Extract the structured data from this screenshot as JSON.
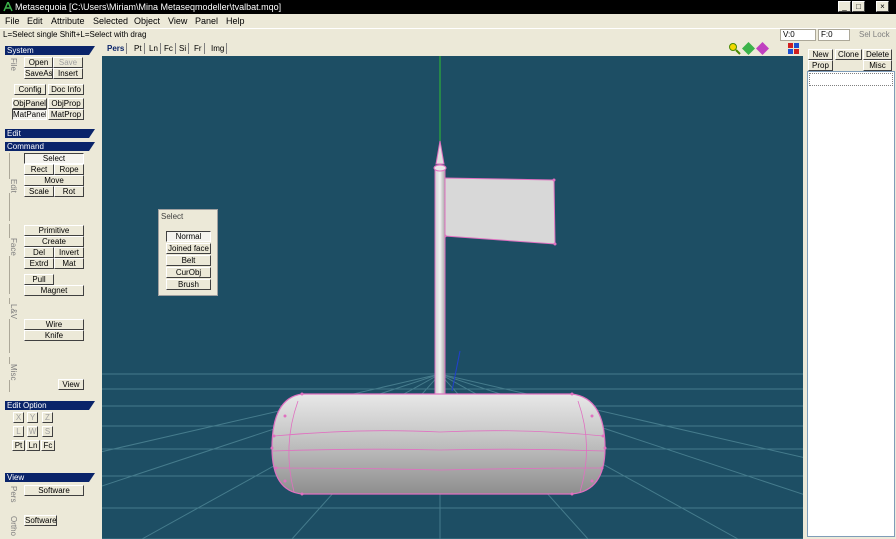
{
  "window": {
    "title": "Metasequoia [C:\\Users\\Miriam\\Mina Metaseqmodeller\\tvalbat.mqo]",
    "buttons": [
      "_",
      "□",
      "×"
    ]
  },
  "menu": [
    "File",
    "Edit",
    "Attribute",
    "Selected",
    "Object",
    "View",
    "Panel",
    "Help"
  ],
  "hint": "L=Select single  Shift+L=Select with drag",
  "readouts": {
    "v": "V:0",
    "f": "F:0",
    "sel_lock": "Sel Lock"
  },
  "left_panel": {
    "system": {
      "header": "System",
      "group_label": "File",
      "open": "Open",
      "save": "Save",
      "save_as": "SaveAs",
      "insert": "Insert",
      "config": "Config",
      "doc_info": "Doc Info",
      "obj_panel": "ObjPanel",
      "obj_prop": "ObjProp",
      "mat_panel": "MatPanel",
      "mat_prop": "MatProp"
    },
    "edit": {
      "header": "Edit"
    },
    "command": {
      "header": "Command",
      "edit_label": "Edit",
      "select": "Select",
      "rect": "Rect",
      "rope": "Rope",
      "move": "Move",
      "scale": "Scale",
      "rot": "Rot",
      "face_label": "Face",
      "primitive": "Primitive",
      "create": "Create",
      "del": "Del",
      "invert": "Invert",
      "extrd": "Extrd",
      "mat": "Mat",
      "pull": "Pull",
      "magnet": "Magnet",
      "lv_label": "L&V",
      "wire": "Wire",
      "knife": "Knife",
      "misc_label": "Misc",
      "view": "View"
    },
    "edit_option": {
      "header": "Edit Option",
      "x": "X",
      "y": "Y",
      "z": "Z",
      "l": "L",
      "w": "W",
      "s": "S",
      "pt": "Pt",
      "ln": "Ln",
      "fc": "Fc"
    },
    "view": {
      "header": "View",
      "pers_label": "Pers",
      "software_top": "Software",
      "software_bottom": "Software",
      "bottom_label": "Ortho"
    }
  },
  "viewport_tabs": [
    "Pers",
    "Pt",
    "Ln",
    "Fc",
    "Si",
    "Fr",
    "Img"
  ],
  "select_dialog": {
    "title": "Select",
    "options": [
      "Normal",
      "Joined face",
      "Belt",
      "CurObj",
      "Brush"
    ],
    "active": "Normal"
  },
  "right_panel": {
    "new": "New",
    "clone": "Clone",
    "delete": "Delete",
    "prop": "Prop",
    "misc": "Misc"
  },
  "colors": {
    "viewport_bg": "#1d4e64",
    "grid": "#4c8494",
    "mesh": "#e070c0",
    "panel_header": "#0a246a",
    "title_bg": "#000000"
  }
}
